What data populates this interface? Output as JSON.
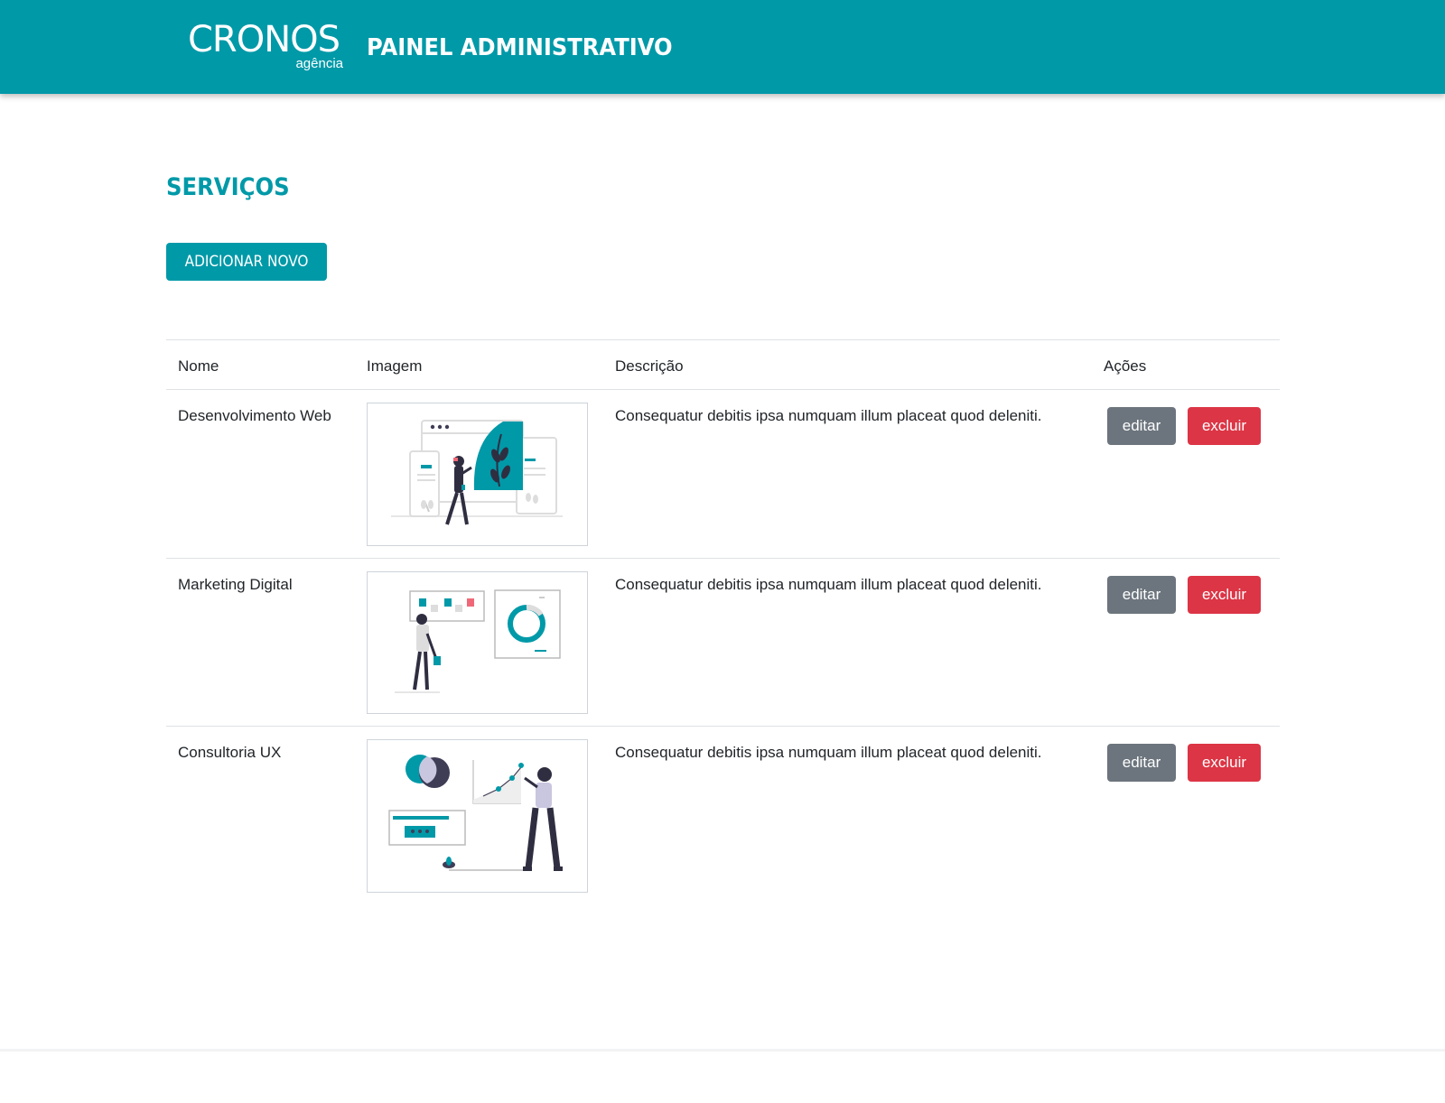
{
  "header": {
    "logo_text": "CRONOS",
    "logo_sub": "agência",
    "title": "PAINEL ADMINISTRATIVO"
  },
  "page": {
    "title": "SERVIÇOS",
    "add_button": "ADICIONAR NOVO"
  },
  "table": {
    "headers": [
      "Nome",
      "Imagem",
      "Descrição",
      "Ações"
    ],
    "rows": [
      {
        "name": "Desenvolvimento Web",
        "image_icon": "web-development-illustration",
        "description": "Consequatur debitis ipsa numquam illum placeat quod deleniti.",
        "edit_label": "editar",
        "delete_label": "excluir"
      },
      {
        "name": "Marketing Digital",
        "image_icon": "digital-marketing-illustration",
        "description": "Consequatur debitis ipsa numquam illum placeat quod deleniti.",
        "edit_label": "editar",
        "delete_label": "excluir"
      },
      {
        "name": "Consultoria UX",
        "image_icon": "ux-consulting-illustration",
        "description": "Consequatur debitis ipsa numquam illum placeat quod deleniti.",
        "edit_label": "editar",
        "delete_label": "excluir"
      }
    ]
  },
  "colors": {
    "primary": "#0099a8",
    "edit_button": "#6c757d",
    "delete_button": "#dc3545",
    "accent_red": "#f06878"
  }
}
